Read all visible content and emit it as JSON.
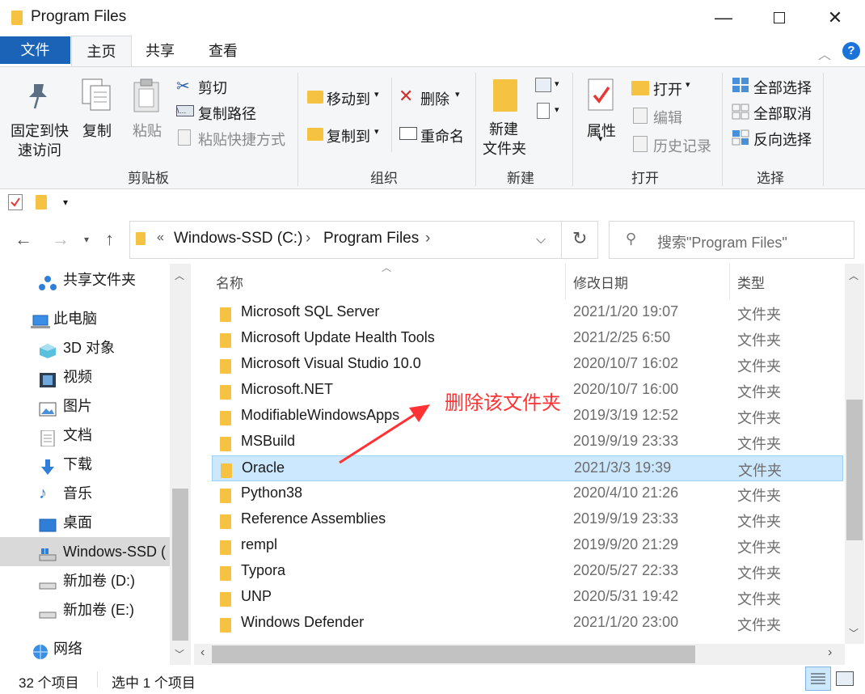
{
  "window": {
    "title": "Program Files"
  },
  "tabs": {
    "file": "文件",
    "home": "主页",
    "share": "共享",
    "view": "查看"
  },
  "ribbon": {
    "clipboard": {
      "group": "剪贴板",
      "pin_line1": "固定到快",
      "pin_line2": "速访问",
      "copy": "复制",
      "paste": "粘贴",
      "cut": "剪切",
      "copy_path": "复制路径",
      "paste_shortcut": "粘贴快捷方式"
    },
    "organize": {
      "group": "组织",
      "move_to": "移动到",
      "copy_to": "复制到",
      "delete": "删除",
      "rename": "重命名"
    },
    "new": {
      "group": "新建",
      "new_folder_line1": "新建",
      "new_folder_line2": "文件夹"
    },
    "open": {
      "group": "打开",
      "properties": "属性",
      "open": "打开",
      "edit": "编辑",
      "history": "历史记录"
    },
    "select": {
      "group": "选择",
      "select_all": "全部选择",
      "select_none": "全部取消",
      "invert": "反向选择"
    }
  },
  "address": {
    "prefix": "«",
    "crumb1": "Windows-SSD (C:)",
    "sep": "›",
    "crumb2": "Program Files",
    "search_placeholder": "搜索\"Program Files\""
  },
  "nav": {
    "items": [
      {
        "label": "共享文件夹",
        "icon": "share-icon"
      },
      {
        "label": "此电脑",
        "icon": "computer-icon"
      },
      {
        "label": "3D 对象",
        "icon": "3d-objects-icon"
      },
      {
        "label": "视频",
        "icon": "video-icon"
      },
      {
        "label": "图片",
        "icon": "pictures-icon"
      },
      {
        "label": "文档",
        "icon": "documents-icon"
      },
      {
        "label": "下载",
        "icon": "download-icon"
      },
      {
        "label": "音乐",
        "icon": "music-icon"
      },
      {
        "label": "桌面",
        "icon": "desktop-icon"
      },
      {
        "label": "Windows-SSD (",
        "icon": "drive-icon"
      },
      {
        "label": "新加卷 (D:)",
        "icon": "drive-icon"
      },
      {
        "label": "新加卷 (E:)",
        "icon": "drive-icon"
      },
      {
        "label": "网络",
        "icon": "network-icon"
      }
    ]
  },
  "columns": {
    "name": "名称",
    "modified": "修改日期",
    "type": "类型"
  },
  "files": [
    {
      "name": "Microsoft SQL Server",
      "date": "2021/1/20 19:07",
      "type": "文件夹"
    },
    {
      "name": "Microsoft Update Health Tools",
      "date": "2021/2/25 6:50",
      "type": "文件夹"
    },
    {
      "name": "Microsoft Visual Studio 10.0",
      "date": "2020/10/7 16:02",
      "type": "文件夹"
    },
    {
      "name": "Microsoft.NET",
      "date": "2020/10/7 16:00",
      "type": "文件夹"
    },
    {
      "name": "ModifiableWindowsApps",
      "date": "2019/3/19 12:52",
      "type": "文件夹"
    },
    {
      "name": "MSBuild",
      "date": "2019/9/19 23:33",
      "type": "文件夹"
    },
    {
      "name": "Oracle",
      "date": "2021/3/3 19:39",
      "type": "文件夹",
      "selected": true
    },
    {
      "name": "Python38",
      "date": "2020/4/10 21:26",
      "type": "文件夹"
    },
    {
      "name": "Reference Assemblies",
      "date": "2019/9/19 23:33",
      "type": "文件夹"
    },
    {
      "name": "rempl",
      "date": "2019/9/20 21:29",
      "type": "文件夹"
    },
    {
      "name": "Typora",
      "date": "2020/5/27 22:33",
      "type": "文件夹"
    },
    {
      "name": "UNP",
      "date": "2020/5/31 19:42",
      "type": "文件夹"
    },
    {
      "name": "Windows Defender",
      "date": "2021/1/20 23:00",
      "type": "文件夹"
    }
  ],
  "annotation": {
    "text": "删除该文件夹",
    "color": "#ff3333"
  },
  "status": {
    "count": "32 个项目",
    "selected": "选中 1 个项目"
  },
  "colors": {
    "accent": "#1a63b6",
    "selection": "#cce8ff",
    "folder": "#f5c242"
  }
}
